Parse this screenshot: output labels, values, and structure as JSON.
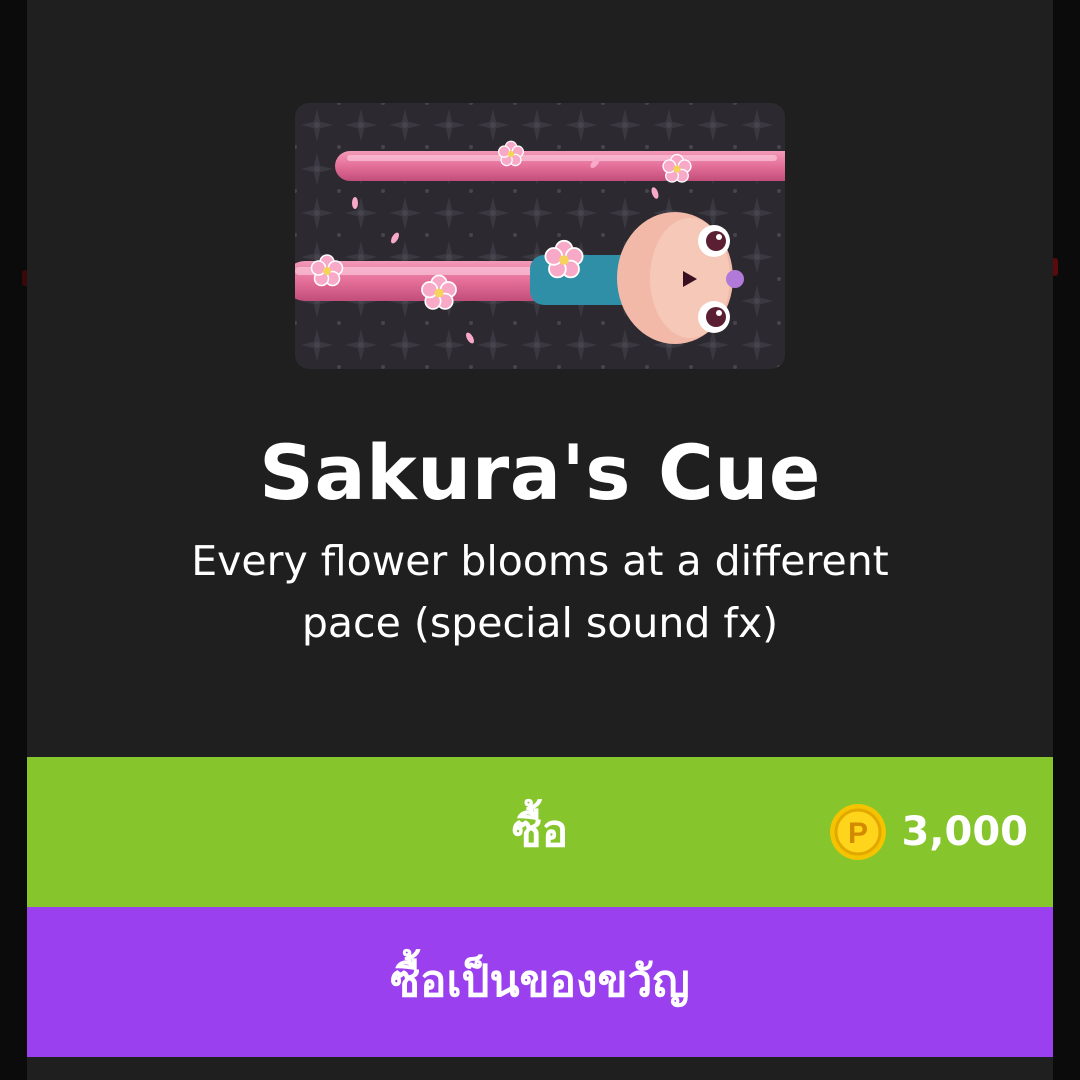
{
  "item": {
    "title": "Sakura's Cue",
    "description": "Every flower blooms at a different pace (special sound fx)"
  },
  "buy": {
    "label": "ซื้อ",
    "price": "3,000",
    "currency_icon": "p-coin-icon"
  },
  "gift": {
    "label": "ซื้อเป็นของขวัญ"
  },
  "colors": {
    "panel": "#1f1f1f",
    "buy_button": "#86c52c",
    "gift_button": "#9b40ef",
    "coin": "#f5c400"
  }
}
